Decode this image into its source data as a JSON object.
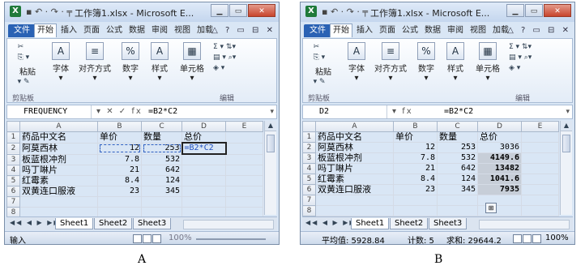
{
  "windowA": {
    "title": "工作簿1.xlsx - Microsoft E...",
    "qat": "▪ ↶ · ↷ · ╤",
    "tabs": [
      "文件",
      "开始",
      "插入",
      "页面",
      "公式",
      "数据",
      "审阅",
      "视图",
      "加载"
    ],
    "tab_right": "△ ? ▭ ⊟ ✕",
    "clipboard": {
      "paste": "粘贴",
      "label": "剪贴板"
    },
    "groups": {
      "font": "字体",
      "align": "对齐方式",
      "number": "数字",
      "style": "样式",
      "cells": "单元格",
      "edit": "编辑"
    },
    "namebox": "FREQUENCY",
    "fbtns": "▾ ✕ ✓ fx",
    "formula": "=B2*C2",
    "columns": [
      "A",
      "B",
      "C",
      "D",
      "E"
    ],
    "rows": [
      {
        "n": "1",
        "a": "药品中文名",
        "b": "单价",
        "c": "数量",
        "d": "总价"
      },
      {
        "n": "2",
        "a": "阿莫西林",
        "b": "12",
        "c": "253",
        "d": "=B2*C2"
      },
      {
        "n": "3",
        "a": "板蓝根冲剂",
        "b": "7.8",
        "c": "532",
        "d": ""
      },
      {
        "n": "4",
        "a": "吗丁啉片",
        "b": "21",
        "c": "642",
        "d": ""
      },
      {
        "n": "5",
        "a": "红霉素",
        "b": "8.4",
        "c": "124",
        "d": ""
      },
      {
        "n": "6",
        "a": "双黄连口服液",
        "b": "23",
        "c": "345",
        "d": ""
      },
      {
        "n": "7",
        "a": "",
        "b": "",
        "c": "",
        "d": ""
      },
      {
        "n": "8",
        "a": "",
        "b": "",
        "c": "",
        "d": ""
      }
    ],
    "nav": "◀◀ ◀ ▶ ▶▶",
    "sheets": [
      "Sheet1",
      "Sheet2",
      "Sheet3"
    ],
    "status_mode": "输入",
    "zoom": "100%"
  },
  "windowB": {
    "title": "工作簿1.xlsx - Microsoft E...",
    "qat": "▪ ↶ · ↷ · ╤",
    "tabs": [
      "文件",
      "开始",
      "插入",
      "页面",
      "公式",
      "数据",
      "审阅",
      "视图",
      "加载"
    ],
    "tab_right": "△ ? ▭ ⊟ ✕",
    "clipboard": {
      "paste": "粘贴",
      "label": "剪贴板"
    },
    "groups": {
      "font": "字体",
      "align": "对齐方式",
      "number": "数字",
      "style": "样式",
      "cells": "单元格",
      "edit": "编辑"
    },
    "namebox": "D2",
    "fbtns": "▾ fx",
    "formula": "=B2*C2",
    "columns": [
      "A",
      "B",
      "C",
      "D",
      "E"
    ],
    "rows": [
      {
        "n": "1",
        "a": "药品中文名",
        "b": "单价",
        "c": "数量",
        "d": "总价"
      },
      {
        "n": "2",
        "a": "阿莫西林",
        "b": "12",
        "c": "253",
        "d": "3036"
      },
      {
        "n": "3",
        "a": "板蓝根冲剂",
        "b": "7.8",
        "c": "532",
        "d": "4149.6"
      },
      {
        "n": "4",
        "a": "吗丁啉片",
        "b": "21",
        "c": "642",
        "d": "13482"
      },
      {
        "n": "5",
        "a": "红霉素",
        "b": "8.4",
        "c": "124",
        "d": "1041.6"
      },
      {
        "n": "6",
        "a": "双黄连口服液",
        "b": "23",
        "c": "345",
        "d": "7935"
      },
      {
        "n": "7",
        "a": "",
        "b": "",
        "c": "",
        "d": ""
      },
      {
        "n": "8",
        "a": "",
        "b": "",
        "c": "",
        "d": ""
      }
    ],
    "nav": "◀◀ ◀ ▶ ▶▶",
    "sheets": [
      "Sheet1",
      "Sheet2",
      "Sheet3"
    ],
    "status": {
      "avg": "平均值: 5928.84",
      "count": "计数: 5",
      "sum": "求和: 29644.2"
    },
    "zoom": "100%"
  },
  "captions": {
    "a": "A",
    "b": "B"
  }
}
